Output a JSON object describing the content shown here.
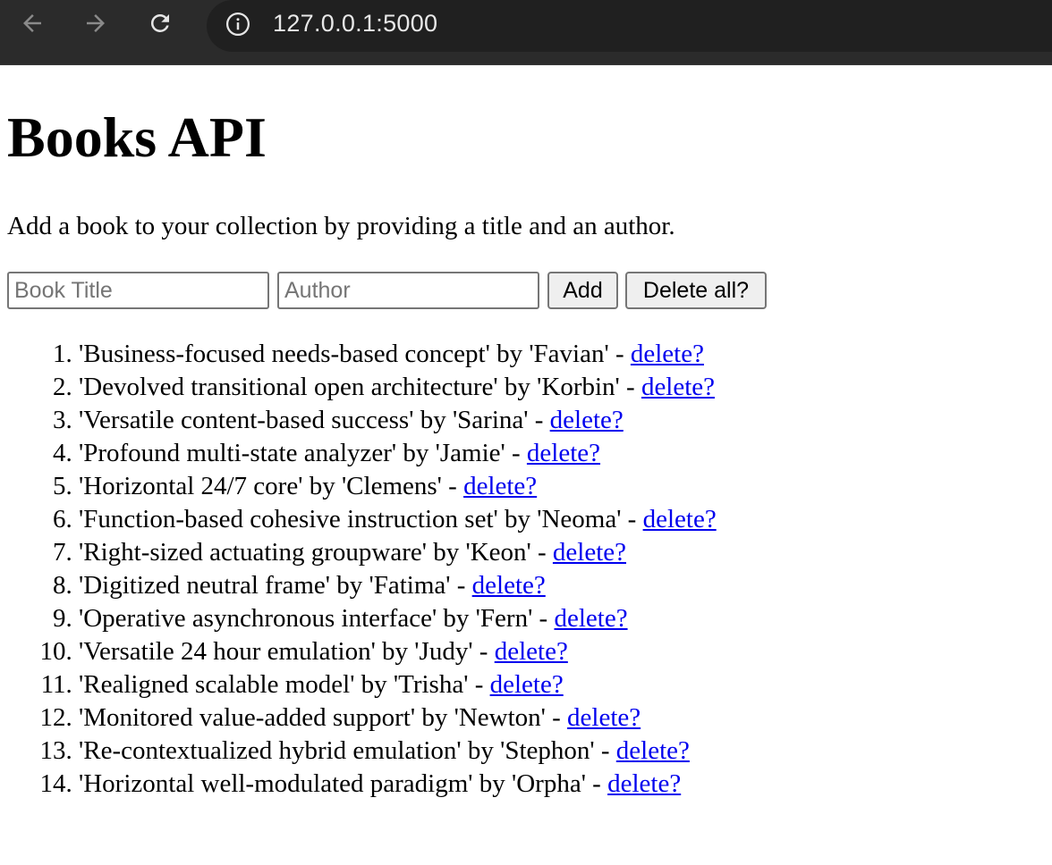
{
  "browser": {
    "url": "127.0.0.1:5000",
    "chrome_color": "#2b2b2b"
  },
  "page": {
    "heading": "Books API",
    "intro": "Add a book to your collection by providing a title and an author.",
    "form": {
      "title_placeholder": "Book Title",
      "author_placeholder": "Author",
      "add_label": "Add",
      "delete_all_label": "Delete all?"
    },
    "delete_link_label": "delete?",
    "link_color": "#0000ee",
    "books": [
      {
        "title": "Business-focused needs-based concept",
        "author": "Favian"
      },
      {
        "title": "Devolved transitional open architecture",
        "author": "Korbin"
      },
      {
        "title": "Versatile content-based success",
        "author": "Sarina"
      },
      {
        "title": "Profound multi-state analyzer",
        "author": "Jamie"
      },
      {
        "title": "Horizontal 24/7 core",
        "author": "Clemens"
      },
      {
        "title": "Function-based cohesive instruction set",
        "author": "Neoma"
      },
      {
        "title": "Right-sized actuating groupware",
        "author": "Keon"
      },
      {
        "title": "Digitized neutral frame",
        "author": "Fatima"
      },
      {
        "title": "Operative asynchronous interface",
        "author": "Fern"
      },
      {
        "title": "Versatile 24 hour emulation",
        "author": "Judy"
      },
      {
        "title": "Realigned scalable model",
        "author": "Trisha"
      },
      {
        "title": "Monitored value-added support",
        "author": "Newton"
      },
      {
        "title": "Re-contextualized hybrid emulation",
        "author": "Stephon"
      },
      {
        "title": "Horizontal well-modulated paradigm",
        "author": "Orpha"
      }
    ]
  }
}
